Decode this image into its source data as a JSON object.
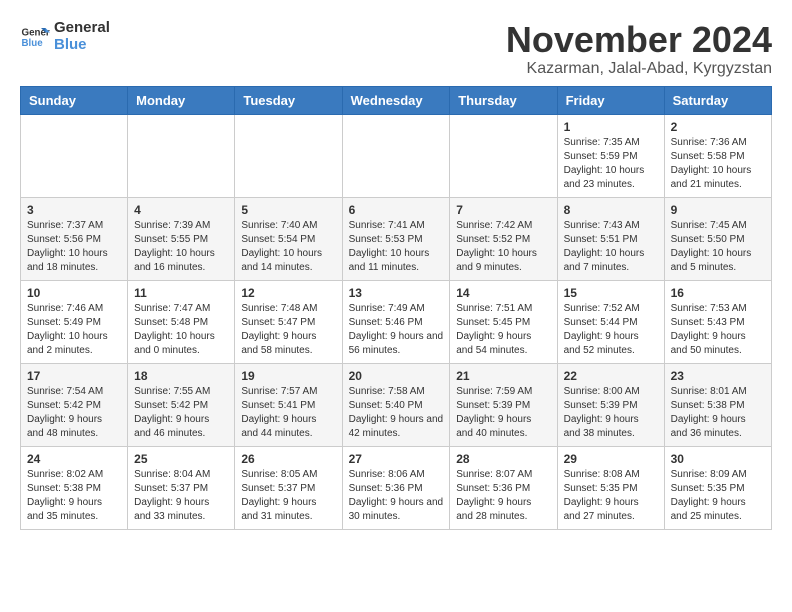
{
  "logo": {
    "line1": "General",
    "line2": "Blue"
  },
  "title": "November 2024",
  "subtitle": "Kazarman, Jalal-Abad, Kyrgyzstan",
  "days_of_week": [
    "Sunday",
    "Monday",
    "Tuesday",
    "Wednesday",
    "Thursday",
    "Friday",
    "Saturday"
  ],
  "weeks": [
    [
      {
        "day": "",
        "info": ""
      },
      {
        "day": "",
        "info": ""
      },
      {
        "day": "",
        "info": ""
      },
      {
        "day": "",
        "info": ""
      },
      {
        "day": "",
        "info": ""
      },
      {
        "day": "1",
        "info": "Sunrise: 7:35 AM\nSunset: 5:59 PM\nDaylight: 10 hours and 23 minutes."
      },
      {
        "day": "2",
        "info": "Sunrise: 7:36 AM\nSunset: 5:58 PM\nDaylight: 10 hours and 21 minutes."
      }
    ],
    [
      {
        "day": "3",
        "info": "Sunrise: 7:37 AM\nSunset: 5:56 PM\nDaylight: 10 hours and 18 minutes."
      },
      {
        "day": "4",
        "info": "Sunrise: 7:39 AM\nSunset: 5:55 PM\nDaylight: 10 hours and 16 minutes."
      },
      {
        "day": "5",
        "info": "Sunrise: 7:40 AM\nSunset: 5:54 PM\nDaylight: 10 hours and 14 minutes."
      },
      {
        "day": "6",
        "info": "Sunrise: 7:41 AM\nSunset: 5:53 PM\nDaylight: 10 hours and 11 minutes."
      },
      {
        "day": "7",
        "info": "Sunrise: 7:42 AM\nSunset: 5:52 PM\nDaylight: 10 hours and 9 minutes."
      },
      {
        "day": "8",
        "info": "Sunrise: 7:43 AM\nSunset: 5:51 PM\nDaylight: 10 hours and 7 minutes."
      },
      {
        "day": "9",
        "info": "Sunrise: 7:45 AM\nSunset: 5:50 PM\nDaylight: 10 hours and 5 minutes."
      }
    ],
    [
      {
        "day": "10",
        "info": "Sunrise: 7:46 AM\nSunset: 5:49 PM\nDaylight: 10 hours and 2 minutes."
      },
      {
        "day": "11",
        "info": "Sunrise: 7:47 AM\nSunset: 5:48 PM\nDaylight: 10 hours and 0 minutes."
      },
      {
        "day": "12",
        "info": "Sunrise: 7:48 AM\nSunset: 5:47 PM\nDaylight: 9 hours and 58 minutes."
      },
      {
        "day": "13",
        "info": "Sunrise: 7:49 AM\nSunset: 5:46 PM\nDaylight: 9 hours and 56 minutes."
      },
      {
        "day": "14",
        "info": "Sunrise: 7:51 AM\nSunset: 5:45 PM\nDaylight: 9 hours and 54 minutes."
      },
      {
        "day": "15",
        "info": "Sunrise: 7:52 AM\nSunset: 5:44 PM\nDaylight: 9 hours and 52 minutes."
      },
      {
        "day": "16",
        "info": "Sunrise: 7:53 AM\nSunset: 5:43 PM\nDaylight: 9 hours and 50 minutes."
      }
    ],
    [
      {
        "day": "17",
        "info": "Sunrise: 7:54 AM\nSunset: 5:42 PM\nDaylight: 9 hours and 48 minutes."
      },
      {
        "day": "18",
        "info": "Sunrise: 7:55 AM\nSunset: 5:42 PM\nDaylight: 9 hours and 46 minutes."
      },
      {
        "day": "19",
        "info": "Sunrise: 7:57 AM\nSunset: 5:41 PM\nDaylight: 9 hours and 44 minutes."
      },
      {
        "day": "20",
        "info": "Sunrise: 7:58 AM\nSunset: 5:40 PM\nDaylight: 9 hours and 42 minutes."
      },
      {
        "day": "21",
        "info": "Sunrise: 7:59 AM\nSunset: 5:39 PM\nDaylight: 9 hours and 40 minutes."
      },
      {
        "day": "22",
        "info": "Sunrise: 8:00 AM\nSunset: 5:39 PM\nDaylight: 9 hours and 38 minutes."
      },
      {
        "day": "23",
        "info": "Sunrise: 8:01 AM\nSunset: 5:38 PM\nDaylight: 9 hours and 36 minutes."
      }
    ],
    [
      {
        "day": "24",
        "info": "Sunrise: 8:02 AM\nSunset: 5:38 PM\nDaylight: 9 hours and 35 minutes."
      },
      {
        "day": "25",
        "info": "Sunrise: 8:04 AM\nSunset: 5:37 PM\nDaylight: 9 hours and 33 minutes."
      },
      {
        "day": "26",
        "info": "Sunrise: 8:05 AM\nSunset: 5:37 PM\nDaylight: 9 hours and 31 minutes."
      },
      {
        "day": "27",
        "info": "Sunrise: 8:06 AM\nSunset: 5:36 PM\nDaylight: 9 hours and 30 minutes."
      },
      {
        "day": "28",
        "info": "Sunrise: 8:07 AM\nSunset: 5:36 PM\nDaylight: 9 hours and 28 minutes."
      },
      {
        "day": "29",
        "info": "Sunrise: 8:08 AM\nSunset: 5:35 PM\nDaylight: 9 hours and 27 minutes."
      },
      {
        "day": "30",
        "info": "Sunrise: 8:09 AM\nSunset: 5:35 PM\nDaylight: 9 hours and 25 minutes."
      }
    ]
  ]
}
